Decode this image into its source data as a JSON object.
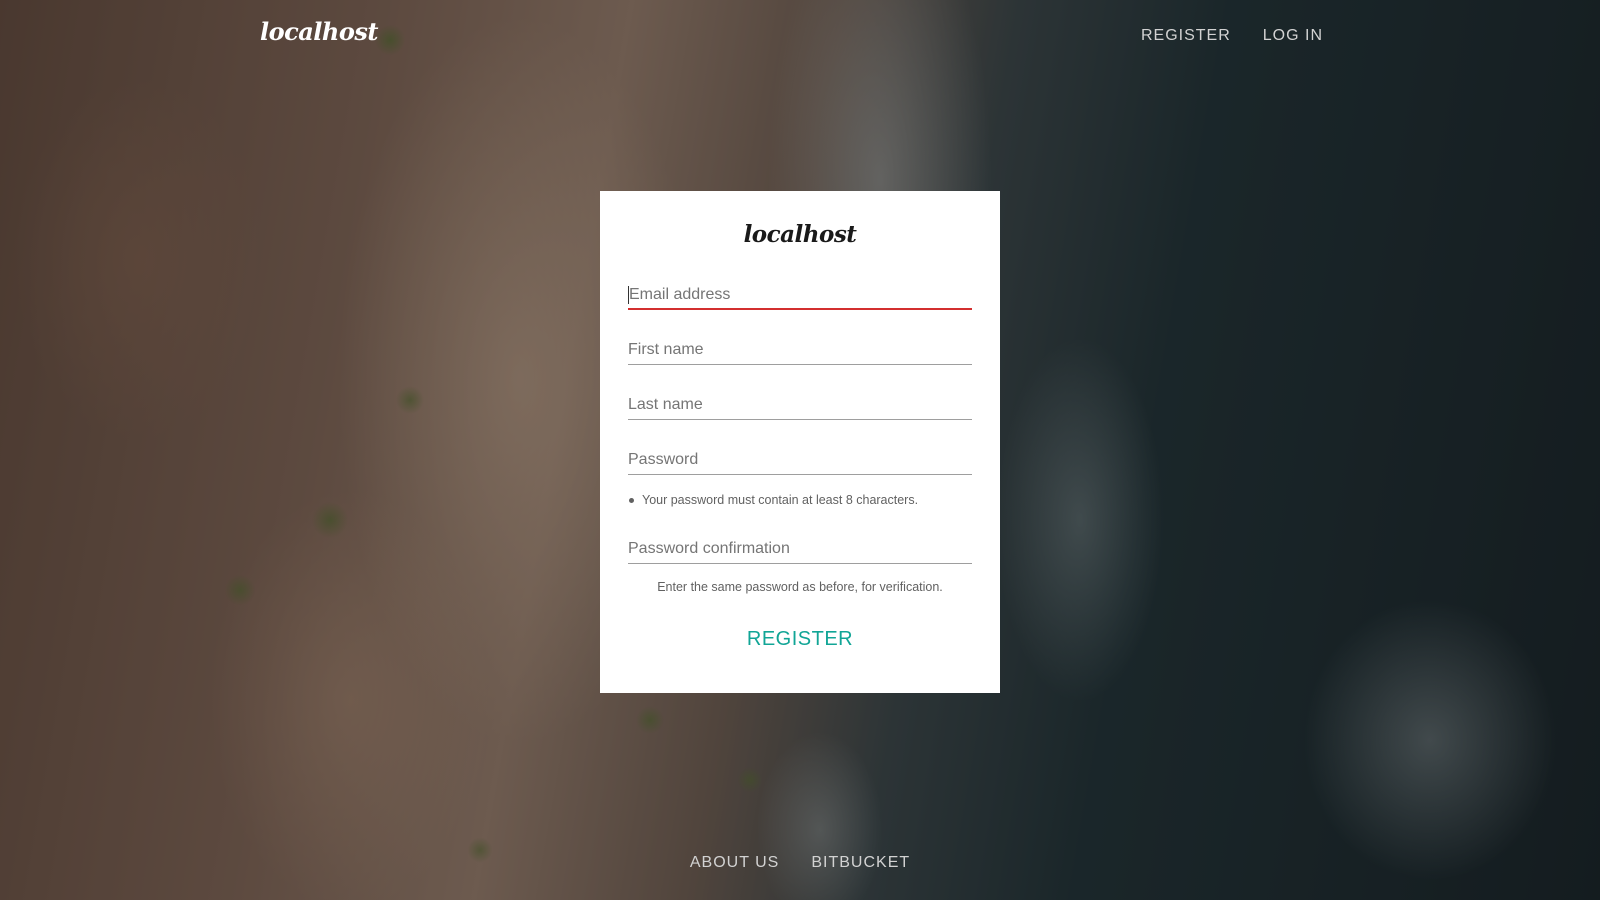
{
  "header": {
    "brand": "localhost",
    "nav": [
      {
        "label": "REGISTER"
      },
      {
        "label": "LOG IN"
      }
    ]
  },
  "card": {
    "logo": "localhost",
    "fields": {
      "email": {
        "placeholder": "Email address",
        "value": ""
      },
      "first_name": {
        "placeholder": "First name",
        "value": ""
      },
      "last_name": {
        "placeholder": "Last name",
        "value": ""
      },
      "password": {
        "placeholder": "Password",
        "value": ""
      },
      "password_confirmation": {
        "placeholder": "Password confirmation",
        "value": ""
      }
    },
    "password_hint": "Your password must contain at least 8 characters.",
    "confirmation_hint": "Enter the same password as before, for verification.",
    "submit_label": "REGISTER"
  },
  "footer": {
    "links": [
      {
        "label": "ABOUT US"
      },
      {
        "label": "BITBUCKET"
      }
    ]
  },
  "colors": {
    "accent": "#11a596",
    "focus_underline": "#d32f2f"
  }
}
